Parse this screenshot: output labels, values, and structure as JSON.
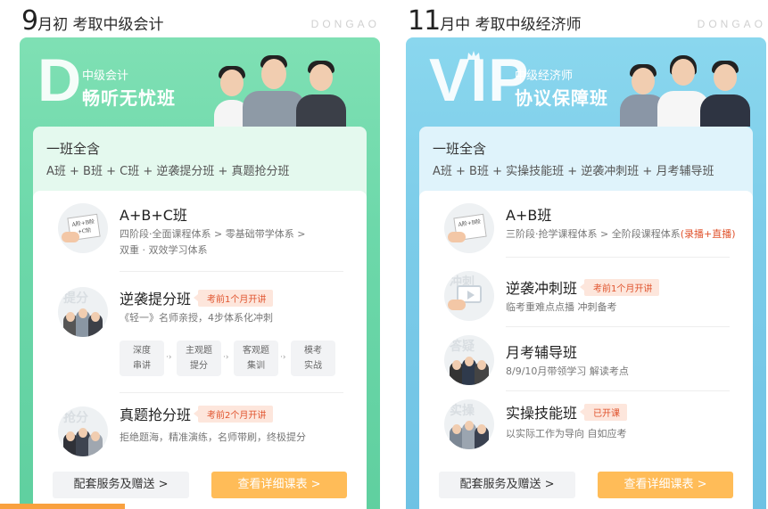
{
  "brand": "DONGAO",
  "left": {
    "title_big": "9",
    "title_rest": "月初 考取中级会计",
    "hero": {
      "letter": "D",
      "sub": "中级会计",
      "main": "畅听无忧班"
    },
    "panel": {
      "title": "一班全含",
      "list": "A班 + B班 + C班 + 逆袭提分班 + 真题抢分班"
    },
    "courses": [
      {
        "name": "A+B+C班",
        "tag": "",
        "desc_a": "四阶段·全面课程体系 > 零基础带学体系 >",
        "desc_b": "双重 · 双效学习体系",
        "thumb_text": "A阶+B阶+C阶"
      },
      {
        "name": "逆袭提分班",
        "tag": "考前1个月开讲",
        "desc_a": "《轻一》名师亲授，4步体系化冲刺",
        "thumb_wm": "提分"
      },
      {
        "name": "真题抢分班",
        "tag": "考前2个月开讲",
        "desc_a": "拒绝题海，精准演练，名师带刷，终极提分",
        "thumb_wm": "抢分"
      }
    ],
    "steps": [
      {
        "a": "深度",
        "b": "串讲"
      },
      {
        "a": "主观题",
        "b": "提分"
      },
      {
        "a": "客观题",
        "b": "集训"
      },
      {
        "a": "模考",
        "b": "实战"
      }
    ],
    "btn_service": "配套服务及赠送 >",
    "btn_detail": "查看详细课表 >"
  },
  "right": {
    "title_big": "11",
    "title_rest": "月中 考取中级经济师",
    "hero": {
      "letter": "VIP",
      "sub": "中级经济师",
      "main": "协议保障班"
    },
    "panel": {
      "title": "一班全含",
      "list": "A班 + B班 + 实操技能班 + 逆袭冲刺班 + 月考辅导班"
    },
    "courses": [
      {
        "name": "A+B班",
        "tag": "",
        "desc_a": "三阶段·抢学课程体系 > 全阶段课程体系",
        "desc_hl": "(录播+直播)",
        "thumb_text": "A阶+B阶"
      },
      {
        "name": "逆袭冲刺班",
        "tag": "考前1个月开讲",
        "desc_a": "临考重难点点播 冲刺备考",
        "thumb_wm": "冲刺"
      },
      {
        "name": "月考辅导班",
        "tag": "",
        "desc_a": "8/9/10月带领学习 解读考点",
        "thumb_wm": "答疑"
      },
      {
        "name": "实操技能班",
        "tag": "已开课",
        "desc_a": "以实际工作为导向 自如应考",
        "thumb_wm": "实操"
      }
    ],
    "btn_service": "配套服务及赠送 >",
    "btn_detail": "查看详细课表 >"
  },
  "colors": {
    "green": "#6dd8aa",
    "blue": "#7ccce9",
    "orange": "#ffbc58",
    "tag_red": "#e0532d"
  }
}
